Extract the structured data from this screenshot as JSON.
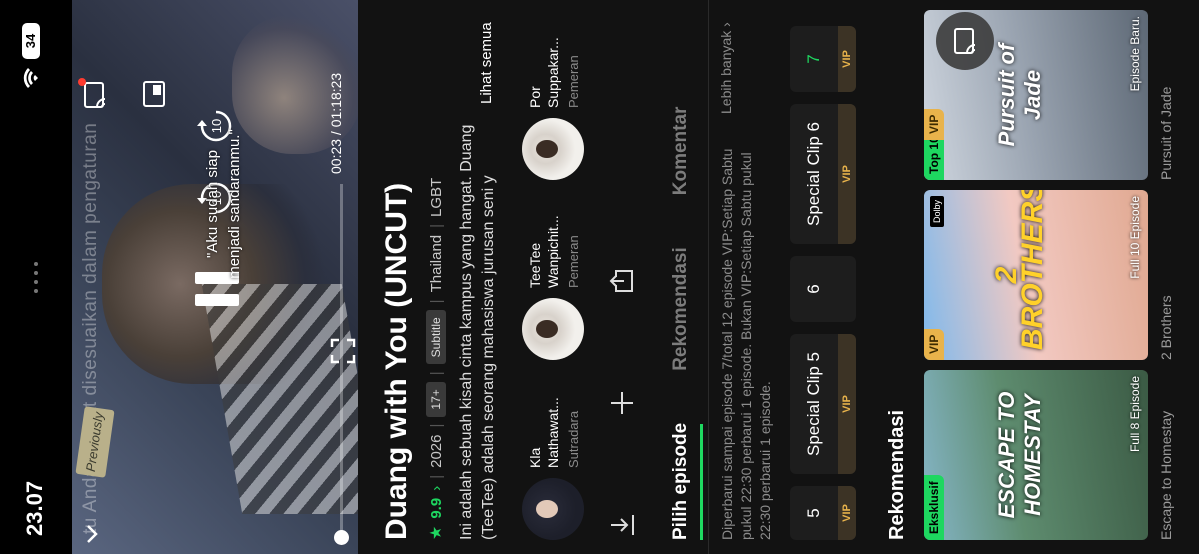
{
  "status": {
    "time": "23.07",
    "battery": "34"
  },
  "video": {
    "overlay_text": "Dapat disesuaikan dalam pengaturan",
    "overlay_prefix": "tu Anda",
    "previously_badge": "Previously",
    "subtitle_line1": "\"Aku sudah siap",
    "subtitle_line2": "menjadi sandaranmu.\"",
    "time_readout": "00:23 / 01:18:23",
    "rewind_label": "10",
    "forward_label": "10",
    "progress_fraction": 0.005
  },
  "details": {
    "title": "Duang with You (UNCUT)",
    "rating": "9.9",
    "year": "2026",
    "age": "17+",
    "subtitle_pill": "Subtitle",
    "country": "Thailand",
    "genre": "LGBT",
    "description": "Ini adalah sebuah kisah cinta kampus yang hangat. Duang (TeeTee) adalah seorang mahasiswa jurusan seni y",
    "see_all": "Lihat semua",
    "cast": [
      {
        "name": "Kla Nathawat...",
        "role": "Sutradara"
      },
      {
        "name": "TeeTee Wanpichit...",
        "role": "Pemeran"
      },
      {
        "name": "Por Suppakar...",
        "role": "Pemeran"
      }
    ],
    "tabs": [
      "Pilih episode",
      "Rekomendasi",
      "Komentar"
    ],
    "update_info": "Diperbarui sampai episode 7/total 12 episode VIP:Setiap Sabtu pukul 22:30 perbarui 1 episode. Bukan VIP:Setiap Sabtu pukul 22:30 perbarui 1 episode.",
    "more_label": "Lebih banyak",
    "episodes": [
      {
        "label": "5",
        "vip": "VIP"
      },
      {
        "label": "Special Clip 5",
        "vip": "VIP"
      },
      {
        "label": "6",
        "vip": ""
      },
      {
        "label": "Special Clip 6",
        "vip": "VIP"
      },
      {
        "label": "7",
        "vip": "VIP"
      }
    ],
    "recommend_title": "Rekomendasi",
    "posters": [
      {
        "tag": "Eksklusif",
        "art_text": "ESCAPE TO HOMESTAY",
        "count": "Full 8 Episode",
        "label": "Escape to Homestay"
      },
      {
        "tag": "VIP",
        "art_text": "2 BROTHERS",
        "dolby": "Dolby",
        "count": "Full 10 Episode",
        "label": "2 Brothers"
      },
      {
        "tag": "Top 10",
        "tag2": "VIP",
        "art_text": "Pursuit of Jade",
        "count": "Episode Baru.",
        "label": "Pursuit of Jade"
      }
    ]
  },
  "colors": {
    "accent": "#1ed760",
    "vip": "#e8b34b",
    "background": "#121212"
  }
}
